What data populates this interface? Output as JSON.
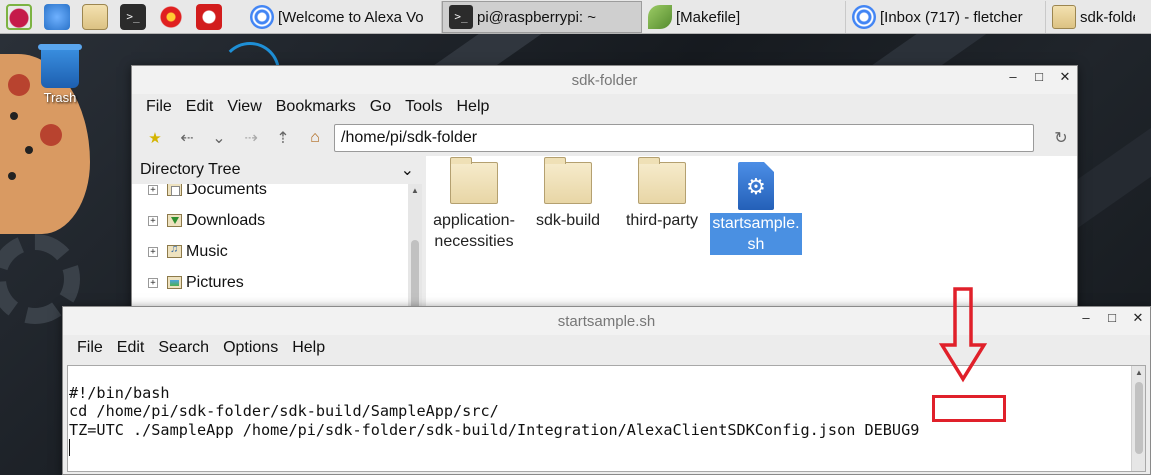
{
  "taskbar": {
    "launchers": [
      {
        "name": "raspberry-menu",
        "icon": "raspberry-icon"
      },
      {
        "name": "web-browser",
        "icon": "globe-icon"
      },
      {
        "name": "file-manager",
        "icon": "folder-icon"
      },
      {
        "name": "terminal",
        "icon": "terminal-icon",
        "glyph": ">_"
      },
      {
        "name": "mathematica",
        "icon": "starburst-icon"
      },
      {
        "name": "wolfram",
        "icon": "wolf-icon"
      }
    ],
    "tasks": [
      {
        "label": "[Welcome to Alexa Vo",
        "icon": "chrome-icon",
        "active": false
      },
      {
        "label": "pi@raspberrypi: ~",
        "icon": "terminal-icon",
        "glyph": ">_",
        "active": true
      },
      {
        "label": "[Makefile]",
        "icon": "leafpad-icon",
        "active": false
      },
      {
        "label": "[Inbox (717) - fletcher",
        "icon": "chrome-icon",
        "active": false
      },
      {
        "label": "sdk-folde",
        "icon": "folder-icon",
        "active": false
      }
    ]
  },
  "desktop": {
    "trash_label": "Trash"
  },
  "file_manager": {
    "title": "sdk-folder",
    "menu": [
      "File",
      "Edit",
      "View",
      "Bookmarks",
      "Go",
      "Tools",
      "Help"
    ],
    "path": "/home/pi/sdk-folder",
    "side_panel_title": "Directory Tree",
    "tree": [
      {
        "label": "Documents",
        "icon": "documents-icon"
      },
      {
        "label": "Downloads",
        "icon": "downloads-icon"
      },
      {
        "label": "Music",
        "icon": "music-icon"
      },
      {
        "label": "Pictures",
        "icon": "pictures-icon"
      }
    ],
    "files": [
      {
        "name": "application-\nnecessities",
        "type": "folder",
        "selected": false
      },
      {
        "name": "sdk-build",
        "type": "folder",
        "selected": false
      },
      {
        "name": "third-party",
        "type": "folder",
        "selected": false
      },
      {
        "name": "startsample.\nsh",
        "type": "script",
        "selected": true
      }
    ]
  },
  "editor": {
    "title": "startsample.sh",
    "menu": [
      "File",
      "Edit",
      "Search",
      "Options",
      "Help"
    ],
    "lines": [
      "#!/bin/bash",
      "cd /home/pi/sdk-folder/sdk-build/SampleApp/src/",
      "TZ=UTC ./SampleApp /home/pi/sdk-folder/sdk-build/Integration/AlexaClientSDKConfig.json DEBUG9"
    ]
  },
  "annotation": {
    "highlighted_text": "DEBUG9",
    "color": "#e0202a"
  },
  "colors": {
    "selection": "#4a90e2",
    "highlight": "#e0202a"
  }
}
